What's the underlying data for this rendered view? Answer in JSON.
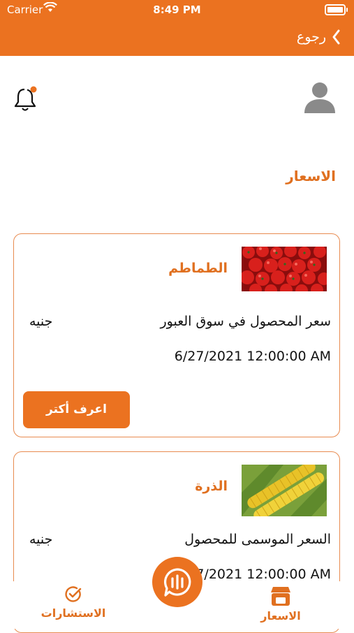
{
  "status_bar": {
    "carrier": "Carrier",
    "time": "8:49 PM"
  },
  "header": {
    "back_label": "رجوع"
  },
  "section_title": "الاسعار",
  "cards": [
    {
      "crop_name": "الطماطم",
      "price_label": "سعر المحصول في سوق العبور",
      "currency": "جنيه",
      "date": "6/27/2021 12:00:00 AM",
      "button_label": "اعرف أكتر",
      "image": "tomatoes-photo"
    },
    {
      "crop_name": "الذرة",
      "price_label": "السعر الموسمى للمحصول",
      "currency": "جنيه",
      "date": "6/27/2021 12:00:00 AM",
      "image": "corn-photo"
    }
  ],
  "bottom_nav": {
    "consultations_label": "الاستشارات",
    "prices_label": "الاسعار",
    "center_icon": "chat-bubble-icon"
  },
  "colors": {
    "accent": "#eb7220",
    "card_border": "#e88b50",
    "avatar_gray": "#8a8a8a"
  }
}
